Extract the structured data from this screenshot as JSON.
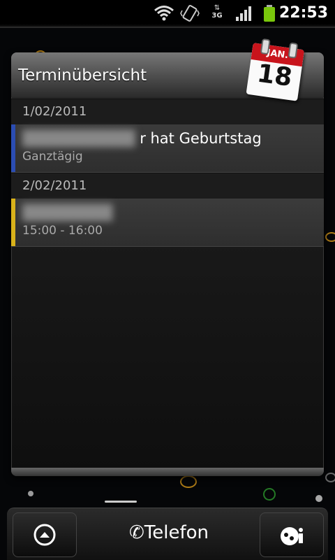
{
  "status_bar": {
    "time": "22:53",
    "icons": [
      "wifi-icon",
      "vibrate-icon",
      "3g-data-icon",
      "signal-icon",
      "battery-icon"
    ],
    "network_label": "3G",
    "battery_color": "#7ac70c"
  },
  "widget": {
    "title": "Terminübersicht",
    "calendar_icon": {
      "month": "JAN.",
      "day": "18"
    },
    "groups": [
      {
        "date": "1/02/2011",
        "events": [
          {
            "title_visible": "r hat Geburtstag",
            "subtitle": "Ganztägig",
            "color": "#2b4db3"
          }
        ]
      },
      {
        "date": "2/02/2011",
        "events": [
          {
            "title_visible": "",
            "subtitle": "15:00 - 16:00",
            "color": "#d9b21a"
          }
        ]
      }
    ]
  },
  "dock": {
    "phone_label": "Telefon",
    "left_button_icon": "up-arrow-icon",
    "right_button_icon": "contacts-icon"
  }
}
